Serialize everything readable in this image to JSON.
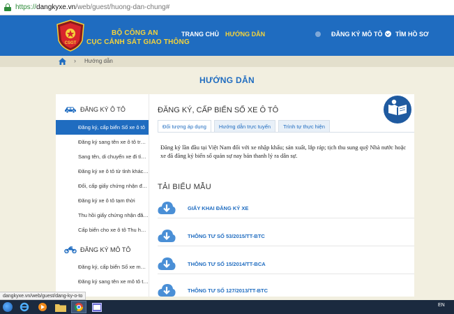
{
  "browser": {
    "url_protocol": "https://",
    "url_host": "dangkyxe.vn",
    "url_path": "/web/guest/huong-dan-chung#",
    "status_url": "dangkyxe.vn/web/guest/dang-ky-o-to"
  },
  "header": {
    "brand_line1": "BỘ CÔNG AN",
    "brand_line2": "CỤC CẢNH SÁT GIAO THÔNG",
    "logo_text": "CSGT",
    "nav": [
      {
        "label": "TRANG CHỦ"
      },
      {
        "label": "HƯỚNG DẪN"
      },
      {
        "label": "ĐĂNG KÝ MÔ TÔ"
      },
      {
        "label": "TÌM HỒ SƠ"
      }
    ]
  },
  "breadcrumb": {
    "current": "Hướng dẫn"
  },
  "page_title": "HƯỚNG DẪN",
  "sidebar": {
    "car_section": {
      "title": "ĐĂNG KÝ Ô TÔ",
      "items": [
        {
          "label": "Đăng ký, cấp biển Số xe ô tô"
        },
        {
          "label": "Đăng ký sang tên xe ô tô trong cùng tỉnh"
        },
        {
          "label": "Sang tên, di chuyển xe đi tỉnh, thành phố khác"
        },
        {
          "label": "Đăng ký xe ô tô từ tỉnh khác chuyển đến"
        },
        {
          "label": "Đổi, cấp giấy chứng nhận đăng ký, biển số xe ô tô"
        },
        {
          "label": "Đăng ký xe ô tô tạm thời"
        },
        {
          "label": "Thu hồi giấy chứng nhận đăng ký, biển số xe ô tô"
        },
        {
          "label": "Cấp biển cho xe ô tô Thu hồi, cấp lại"
        }
      ]
    },
    "moto_section": {
      "title": "ĐĂNG KÝ MÔ TÔ",
      "items": [
        {
          "label": "Đăng ký, cấp biển Số xe mô tô"
        },
        {
          "label": "Đăng ký sang tên xe mô tô trong cùng tỉnh"
        }
      ]
    }
  },
  "main": {
    "title": "ĐĂNG KÝ, CẤP BIỂN SỐ XE Ô TÔ",
    "tabs": [
      {
        "label": "Đối tượng áp dụng"
      },
      {
        "label": "Hướng dẫn trực tuyến"
      },
      {
        "label": "Trình tự thực hiện"
      }
    ],
    "paragraph": "Đăng ký lần đầu tại Việt Nam đối với xe nhập khẩu; sản xuất, lắp ráp; tịch thu sung quỹ Nhà nước hoặc xe đã đăng ký biển số quản sự nay bán thanh lý ra dân sự.",
    "downloads_title": "TẢI BIỂU MẪU",
    "downloads": [
      {
        "label": "GIẤY KHAI ĐĂNG KÝ XE"
      },
      {
        "label": "THÔNG TƯ SỐ 53/2015/TT-BTC"
      },
      {
        "label": "THÔNG TƯ SỐ 15/2014/TT-BCA"
      },
      {
        "label": "THÔNG TƯ SỐ 127/2013/TT-BTC"
      }
    ]
  },
  "taskbar": {
    "language": "EN"
  },
  "colors": {
    "brand_blue": "#1f6cc0",
    "brand_yellow": "#f5d33a",
    "page_bg": "#f2efe0"
  }
}
